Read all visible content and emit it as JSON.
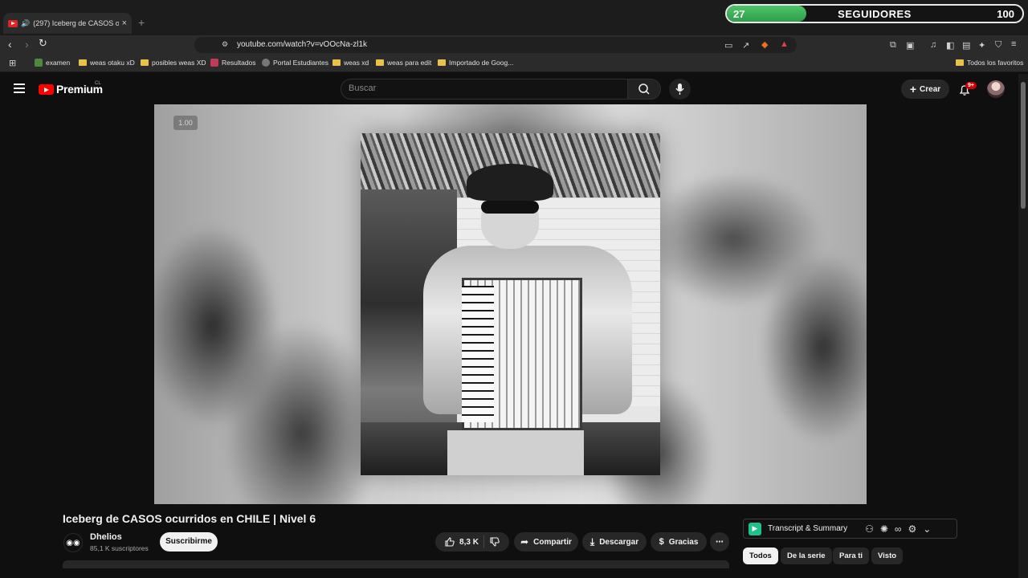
{
  "browser": {
    "tab_title": "(297) Iceberg de CASOS ocurr",
    "tab_speaker_icon": "speaker-icon",
    "new_tab_label": "+",
    "url": "youtube.com/watch?v=vOOcNa-zl1k"
  },
  "overlay": {
    "followers_current": "27",
    "followers_label": "SEGUIDORES",
    "followers_goal": "100",
    "progress_fraction": 0.27
  },
  "bookmarks": [
    {
      "label": "examen",
      "icon": "globe-icon"
    },
    {
      "label": "weas otaku xD",
      "icon": "folder-icon"
    },
    {
      "label": "posibles weas XD",
      "icon": "folder-icon"
    },
    {
      "label": "Resultados",
      "icon": "site-icon"
    },
    {
      "label": "Portal Estudiantes",
      "icon": "globe-icon"
    },
    {
      "label": "weas xd",
      "icon": "folder-icon"
    },
    {
      "label": "weas para edit",
      "icon": "folder-icon"
    },
    {
      "label": "Importado de Goog...",
      "icon": "folder-icon"
    }
  ],
  "bookmarks_right": "Todos los favoritos",
  "youtube": {
    "brand": "Premium",
    "region": "CL",
    "search_placeholder": "Buscar",
    "create_label": "Crear",
    "notifications_badge": "9+"
  },
  "player": {
    "speed_label": "1.00"
  },
  "video": {
    "title": "Iceberg de CASOS ocurridos en CHILE | Nivel 6",
    "channel_name": "Dhelios",
    "channel_subs": "85,1 K suscriptores",
    "subscribe_label": "Suscribirme",
    "likes": "8,3 K",
    "share_label": "Compartir",
    "download_label": "Descargar",
    "thanks_label": "Gracias"
  },
  "extension": {
    "name": "Transcript & Summary"
  },
  "chips": [
    "Todos",
    "De la serie",
    "Para ti",
    "Visto"
  ],
  "colors": {
    "youtube_red": "#ff0000",
    "progress_green": "#3fb55a",
    "page_bg": "#0f0f0f"
  }
}
